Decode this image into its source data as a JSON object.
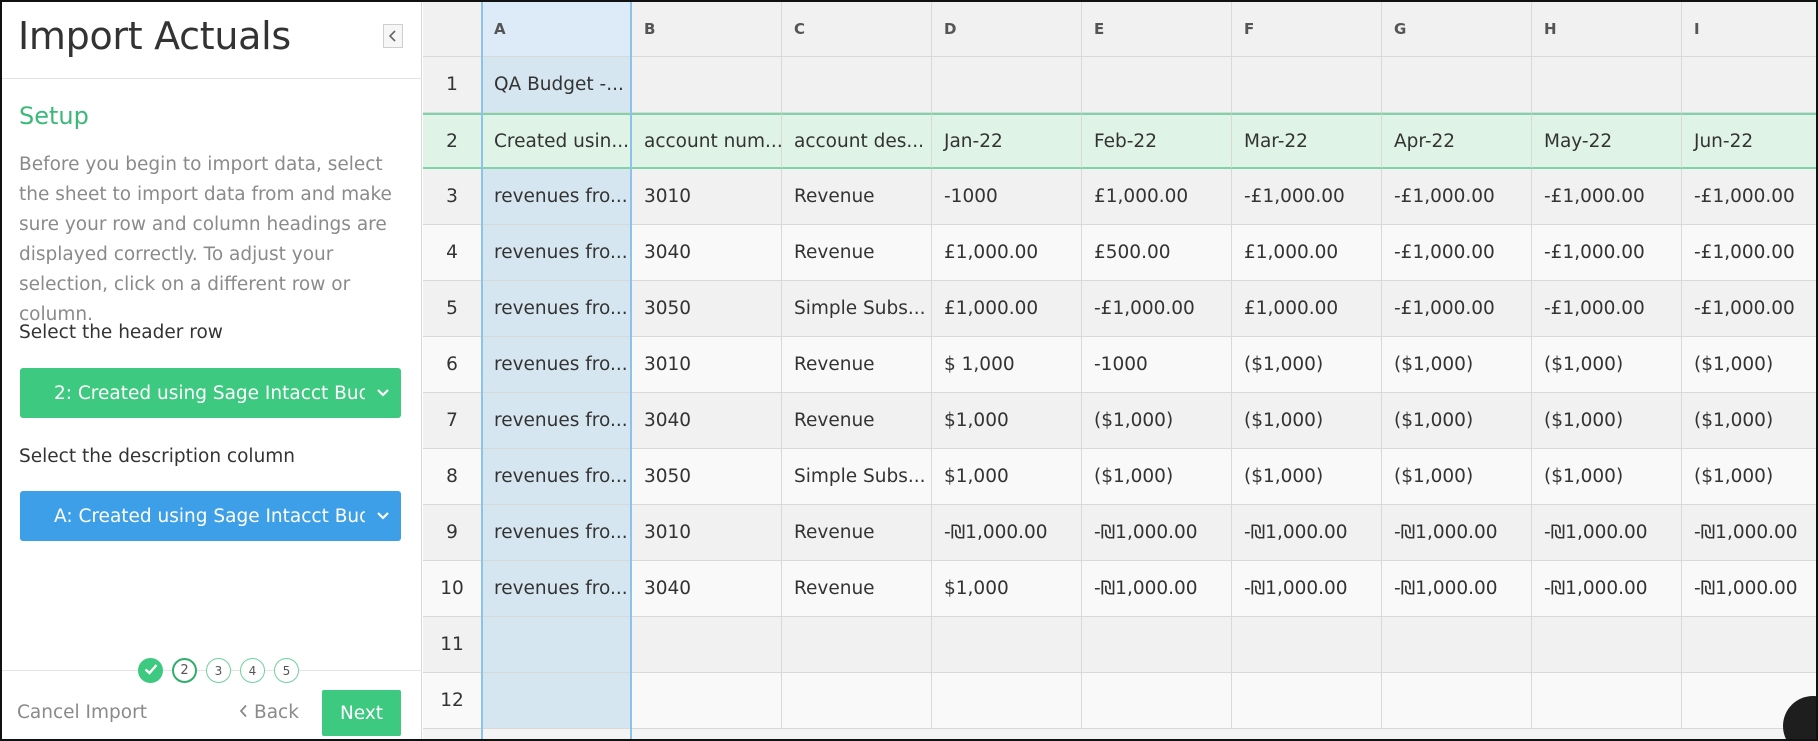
{
  "sidebar": {
    "title": "Import Actuals",
    "section_title": "Setup",
    "description": "Before you begin to import data, select the sheet to import data from and make sure your row and column headings are displayed correctly. To adjust your selection, click on a different row or column.",
    "header_row_label": "Select the header row",
    "header_row_value": "2: Created using Sage Intacct Bud...",
    "description_col_label": "Select the description column",
    "description_col_value": "A: Created using Sage Intacct Bud...",
    "steps": [
      "2",
      "3",
      "4",
      "5"
    ],
    "cancel_label": "Cancel Import",
    "back_label": "Back",
    "next_label": "Next"
  },
  "colors": {
    "accent_green": "#3dc97f",
    "accent_blue": "#3d9fe8",
    "header_row_highlight": "#dff3e7",
    "desc_col_highlight": "#d6e6f1"
  },
  "grid": {
    "columns": [
      "A",
      "B",
      "C",
      "D",
      "E",
      "F",
      "G",
      "H",
      "I"
    ],
    "rows": [
      {
        "num": "1",
        "cells": [
          "QA Budget -...",
          "",
          "",
          "",
          "",
          "",
          "",
          "",
          ""
        ]
      },
      {
        "num": "2",
        "cells": [
          "Created usin...",
          "account num...",
          "account des...",
          "Jan-22",
          "Feb-22",
          "Mar-22",
          "Apr-22",
          "May-22",
          "Jun-22"
        ]
      },
      {
        "num": "3",
        "cells": [
          "revenues fro...",
          "3010",
          "Revenue",
          "-1000",
          "£1,000.00",
          "-£1,000.00",
          "-£1,000.00",
          "-£1,000.00",
          "-£1,000.00"
        ]
      },
      {
        "num": "4",
        "cells": [
          "revenues fro...",
          "3040",
          "Revenue",
          "£1,000.00",
          "£500.00",
          "£1,000.00",
          "-£1,000.00",
          "-£1,000.00",
          "-£1,000.00"
        ]
      },
      {
        "num": "5",
        "cells": [
          "revenues fro...",
          "3050",
          "Simple Subs...",
          "£1,000.00",
          "-£1,000.00",
          "£1,000.00",
          "-£1,000.00",
          "-£1,000.00",
          "-£1,000.00"
        ]
      },
      {
        "num": "6",
        "cells": [
          "revenues fro...",
          "3010",
          "Revenue",
          "$ 1,000",
          "-1000",
          "($1,000)",
          "($1,000)",
          "($1,000)",
          "($1,000)"
        ]
      },
      {
        "num": "7",
        "cells": [
          "revenues fro...",
          "3040",
          "Revenue",
          "$1,000",
          "($1,000)",
          "($1,000)",
          "($1,000)",
          "($1,000)",
          "($1,000)"
        ]
      },
      {
        "num": "8",
        "cells": [
          "revenues fro...",
          "3050",
          "Simple Subs...",
          "$1,000",
          "($1,000)",
          "($1,000)",
          "($1,000)",
          "($1,000)",
          "($1,000)"
        ]
      },
      {
        "num": "9",
        "cells": [
          "revenues fro...",
          "3010",
          "Revenue",
          "-₪1,000.00",
          "-₪1,000.00",
          "-₪1,000.00",
          "-₪1,000.00",
          "-₪1,000.00",
          "-₪1,000.00"
        ]
      },
      {
        "num": "10",
        "cells": [
          "revenues fro...",
          "3040",
          "Revenue",
          "$1,000",
          "-₪1,000.00",
          "-₪1,000.00",
          "-₪1,000.00",
          "-₪1,000.00",
          "-₪1,000.00"
        ]
      },
      {
        "num": "11",
        "cells": [
          "",
          "",
          "",
          "",
          "",
          "",
          "",
          "",
          ""
        ]
      },
      {
        "num": "12",
        "cells": [
          "",
          "",
          "",
          "",
          "",
          "",
          "",
          "",
          ""
        ]
      }
    ]
  }
}
